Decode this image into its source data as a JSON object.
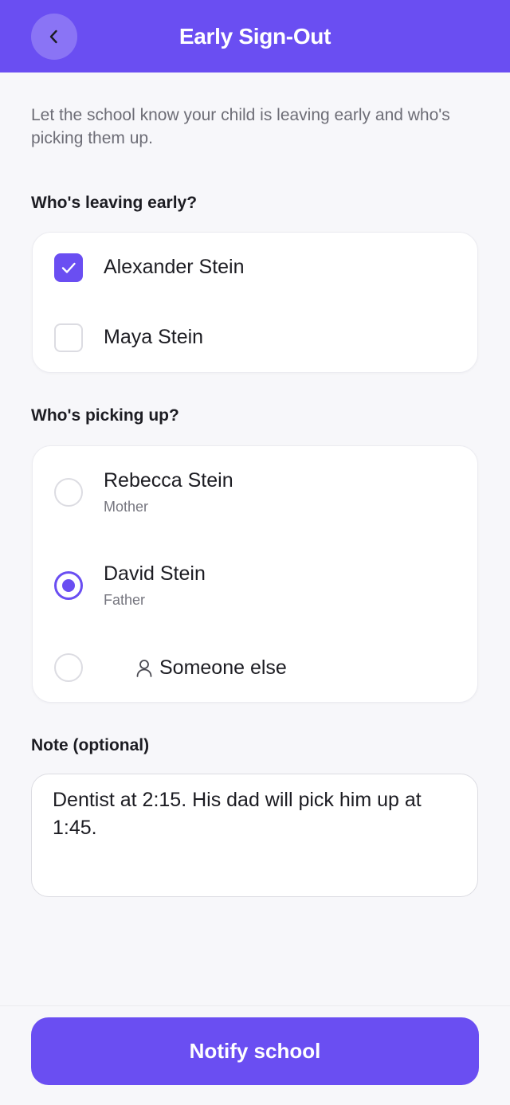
{
  "header": {
    "title": "Early Sign-Out",
    "back_icon": "chevron-left-icon"
  },
  "intro_text": "Let the school know your child is leaving early and who's picking them up.",
  "children_section": {
    "label": "Who's leaving early?",
    "items": [
      {
        "name": "Alexander Stein",
        "checked": true
      },
      {
        "name": "Maya Stein",
        "checked": false
      }
    ]
  },
  "pickup_section": {
    "label": "Who's picking up?",
    "options": [
      {
        "name": "Rebecca Stein",
        "relation": "Mother",
        "selected": false
      },
      {
        "name": "David Stein",
        "relation": "Father",
        "selected": true
      },
      {
        "name": "Someone else",
        "icon": "person-icon",
        "selected": false
      }
    ]
  },
  "note": {
    "label": "Note (optional)",
    "value": "Dentist at 2:15. His dad will pick him up at 1:45."
  },
  "footer": {
    "button_label": "Notify school"
  },
  "colors": {
    "accent": "#6a4ef2",
    "background": "#f7f7fa",
    "card": "#ffffff"
  }
}
